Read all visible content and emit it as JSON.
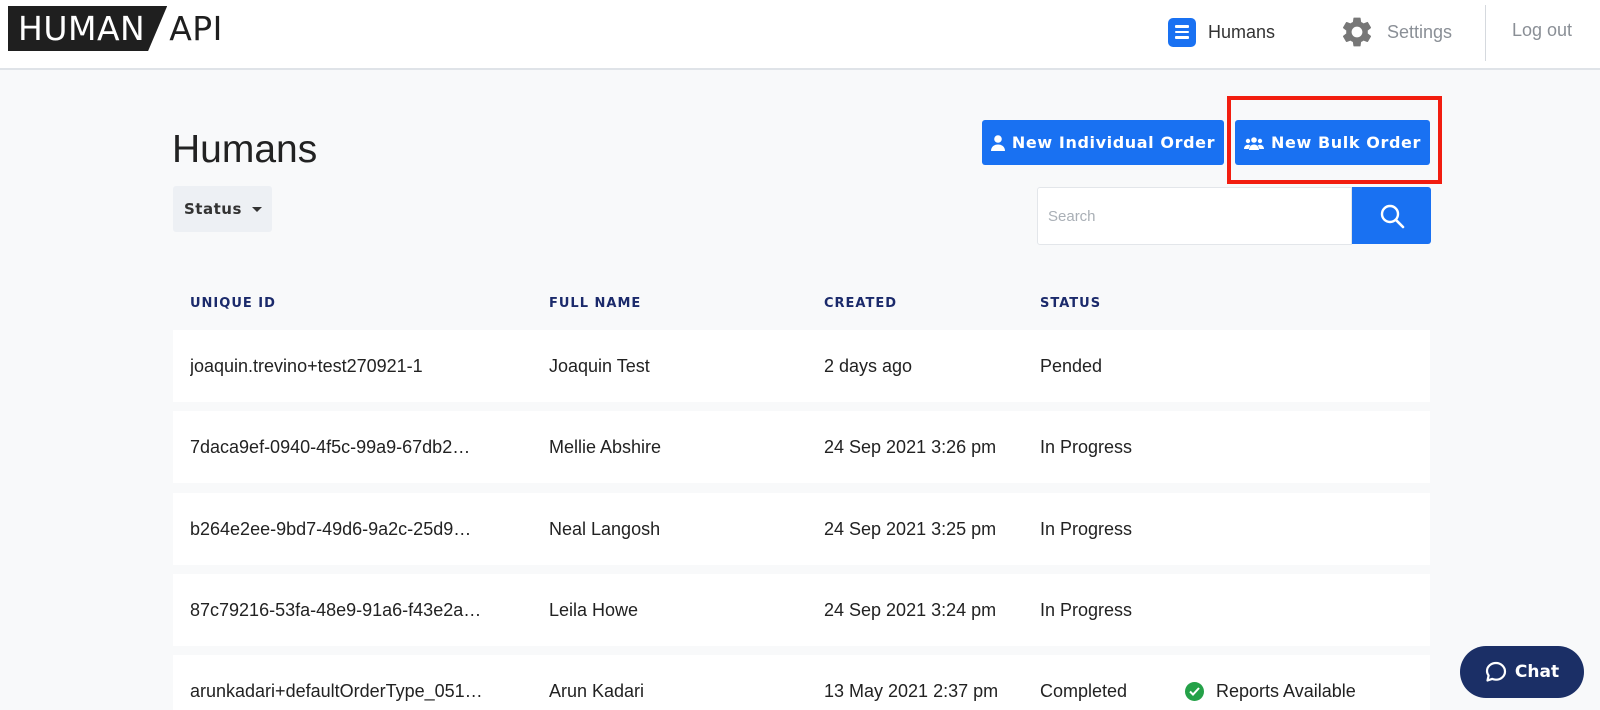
{
  "header": {
    "logo_left": "HUMAN",
    "logo_right": "API",
    "nav": {
      "humans_label": "Humans",
      "settings_label": "Settings",
      "logout_label": "Log out"
    }
  },
  "page": {
    "title": "Humans",
    "status_filter_label": "Status",
    "buttons": {
      "new_individual": "New Individual Order",
      "new_bulk": "New Bulk Order"
    },
    "search": {
      "placeholder": "Search",
      "value": ""
    }
  },
  "table": {
    "headers": {
      "unique_id": "UNIQUE ID",
      "full_name": "FULL NAME",
      "created": "CREATED",
      "status": "STATUS"
    },
    "rows": [
      {
        "unique_id": "joaquin.trevino+test270921-1",
        "full_name": "Joaquin Test",
        "created": "2 days ago",
        "status": "Pended",
        "extra": ""
      },
      {
        "unique_id": "7daca9ef-0940-4f5c-99a9-67db2…",
        "full_name": "Mellie Abshire",
        "created": "24 Sep 2021 3:26 pm",
        "status": "In Progress",
        "extra": ""
      },
      {
        "unique_id": "b264e2ee-9bd7-49d6-9a2c-25d9…",
        "full_name": "Neal Langosh",
        "created": "24 Sep 2021 3:25 pm",
        "status": "In Progress",
        "extra": ""
      },
      {
        "unique_id": "87c79216-53fa-48e9-91a6-f43e2a…",
        "full_name": "Leila Howe",
        "created": "24 Sep 2021 3:24 pm",
        "status": "In Progress",
        "extra": ""
      },
      {
        "unique_id": "arunkadari+defaultOrderType_051…",
        "full_name": "Arun Kadari",
        "created": "13 May 2021 2:37 pm",
        "status": "Completed",
        "extra": "Reports Available"
      }
    ]
  },
  "chat": {
    "label": "Chat"
  },
  "colors": {
    "accent": "#1971f2",
    "highlight": "#f21d0f",
    "chat_bg": "#1b2f66",
    "header_text": "#1b2a6b",
    "success": "#24a148"
  }
}
